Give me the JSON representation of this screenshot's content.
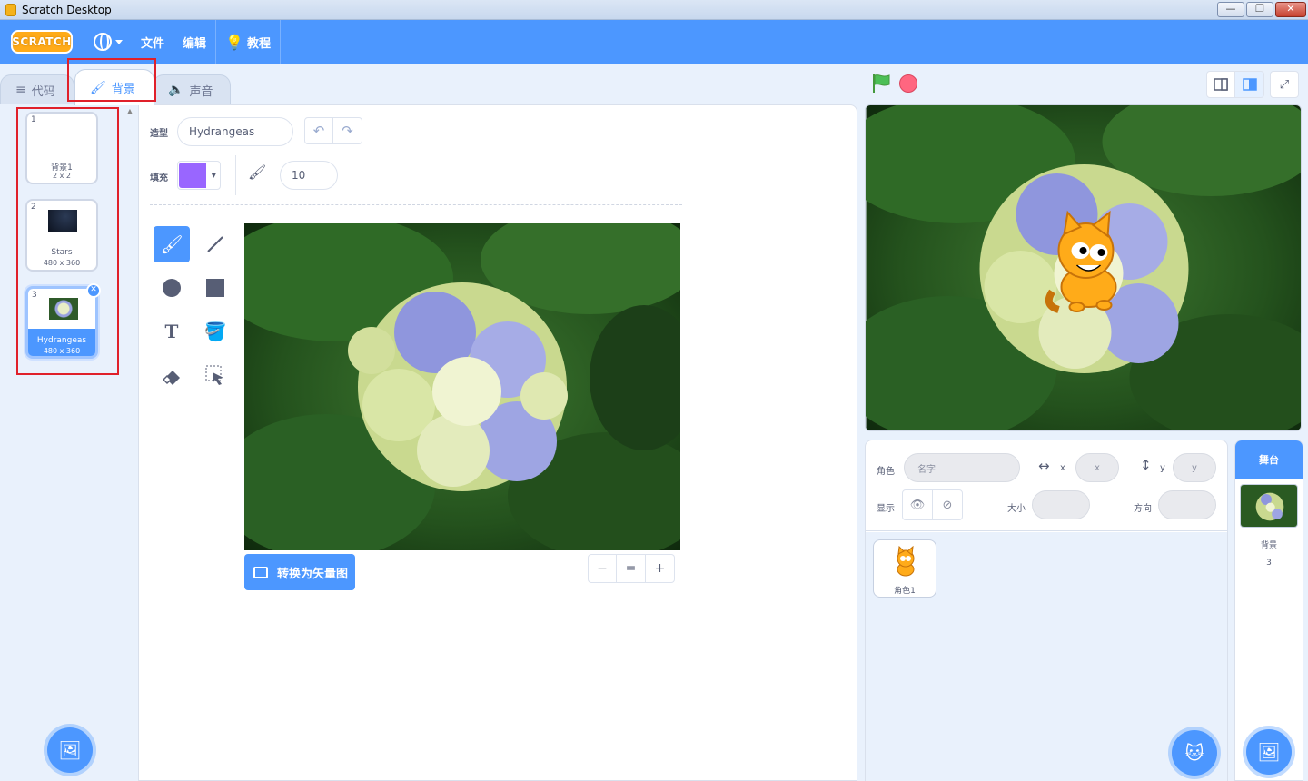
{
  "window": {
    "title": "Scratch Desktop"
  },
  "menubar": {
    "logo": "SCRATCH",
    "file": "文件",
    "edit": "编辑",
    "tutorials": "教程"
  },
  "tabs": [
    {
      "label": "代码",
      "icon": "code-icon"
    },
    {
      "label": "背景",
      "icon": "brush-icon",
      "active": true
    },
    {
      "label": "声音",
      "icon": "speaker-icon"
    }
  ],
  "backdrops": [
    {
      "index": "1",
      "name": "背景1",
      "size": "2 x 2"
    },
    {
      "index": "2",
      "name": "Stars",
      "size": "480 x 360"
    },
    {
      "index": "3",
      "name": "Hydrangeas",
      "size": "480 x 360",
      "selected": true
    }
  ],
  "editor": {
    "costume_label": "造型",
    "costume_name": "Hydrangeas",
    "fill_label": "填充",
    "fill_color": "#9966ff",
    "brush_size": "10",
    "convert_label": "转换为矢量图",
    "zoom_out": "−",
    "zoom_reset": "=",
    "zoom_in": "+"
  },
  "sprite_info": {
    "sprite_label": "角色",
    "name_placeholder": "名字",
    "x_label": "x",
    "x_placeholder": "x",
    "y_label": "y",
    "y_placeholder": "y",
    "show_label": "显示",
    "size_label": "大小",
    "direction_label": "方向"
  },
  "sprites": [
    {
      "name": "角色1"
    }
  ],
  "stage_selector": {
    "header": "舞台",
    "label": "背景",
    "count": "3"
  },
  "colors": {
    "accent": "#4c97ff",
    "highlight_box": "#e0202a",
    "stop": "#ff6680",
    "flag": "#4cbf56"
  }
}
